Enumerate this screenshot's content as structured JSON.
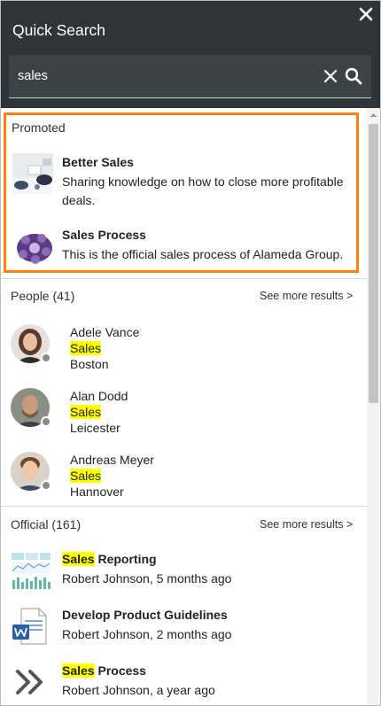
{
  "header": {
    "title": "Quick Search",
    "close_icon": "close-icon"
  },
  "search": {
    "value": "sales",
    "clear_icon": "clear-icon",
    "search_icon": "search-icon"
  },
  "promoted": {
    "label": "Promoted",
    "items": [
      {
        "title": "Better Sales",
        "description": "Sharing knowledge on how to close more profitable deals.",
        "thumb": "meeting-photo"
      },
      {
        "title": "Sales Process",
        "description": "This is the official sales process of Alameda Group.",
        "thumb": "process-diagram"
      }
    ]
  },
  "people": {
    "label": "People (41)",
    "see_more": "See more results >",
    "items": [
      {
        "name": "Adele Vance",
        "department": "Sales",
        "location": "Boston"
      },
      {
        "name": "Alan Dodd",
        "department": "Sales",
        "location": "Leicester"
      },
      {
        "name": "Andreas Meyer",
        "department": "Sales",
        "location": "Hannover"
      }
    ]
  },
  "official": {
    "label": "Official (161)",
    "see_more": "See more results >",
    "items": [
      {
        "title_highlight": "Sales",
        "title_rest": " Reporting",
        "meta": "Robert Johnson, 5 months ago",
        "thumb": "report-thumbnail"
      },
      {
        "title_highlight": "",
        "title_rest": "Develop Product Guidelines",
        "meta": "Robert Johnson, 2 months ago",
        "thumb": "word-document-icon"
      },
      {
        "title_highlight": "Sales",
        "title_rest": " Process",
        "meta": "Robert Johnson, a year ago",
        "thumb": "double-chevron-icon"
      }
    ]
  },
  "colors": {
    "header_bg": "#2f3439",
    "promoted_border": "#ff7f0a",
    "highlight": "#ffff00"
  }
}
